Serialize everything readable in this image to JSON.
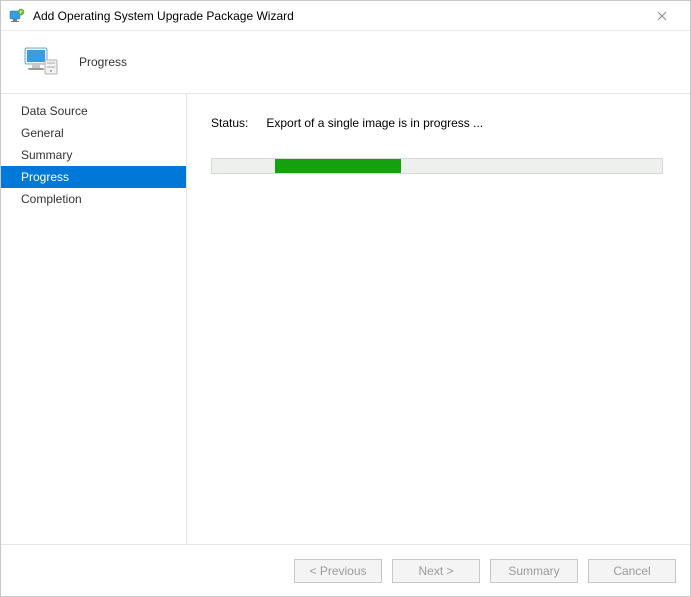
{
  "window": {
    "title": "Add Operating System Upgrade Package Wizard"
  },
  "header": {
    "title": "Progress"
  },
  "sidebar": {
    "items": [
      {
        "label": "Data Source",
        "selected": false
      },
      {
        "label": "General",
        "selected": false
      },
      {
        "label": "Summary",
        "selected": false
      },
      {
        "label": "Progress",
        "selected": true
      },
      {
        "label": "Completion",
        "selected": false
      }
    ]
  },
  "main": {
    "status_label": "Status:",
    "status_value": "Export of a single image is in progress ...",
    "progress": {
      "left_pct": 14,
      "width_pct": 28
    }
  },
  "footer": {
    "previous": "< Previous",
    "next": "Next >",
    "summary": "Summary",
    "cancel": "Cancel"
  }
}
